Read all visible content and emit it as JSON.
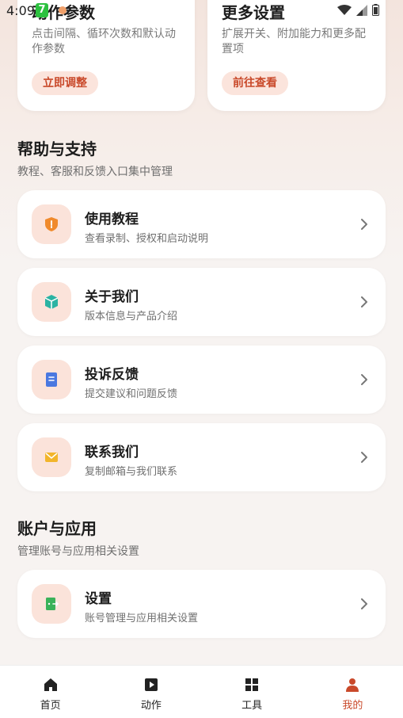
{
  "status_bar": {
    "time": "4:09",
    "app_badge": "7"
  },
  "top_cards": [
    {
      "title": "动作参数",
      "desc": "点击间隔、循环次数和默认动作参数",
      "button": "立即调整"
    },
    {
      "title": "更多设置",
      "desc": "扩展开关、附加能力和更多配置项",
      "button": "前往查看"
    }
  ],
  "help_section": {
    "title": "帮助与支持",
    "subtitle": "教程、客服和反馈入口集中管理",
    "items": [
      {
        "title": "使用教程",
        "subtitle": "查看录制、授权和启动说明",
        "icon": "shield-icon",
        "color": "#f08a2c"
      },
      {
        "title": "关于我们",
        "subtitle": "版本信息与产品介绍",
        "icon": "cube-icon",
        "color": "#2bb3a3"
      },
      {
        "title": "投诉反馈",
        "subtitle": "提交建议和问题反馈",
        "icon": "document-icon",
        "color": "#4a78e0"
      },
      {
        "title": "联系我们",
        "subtitle": "复制邮箱与我们联系",
        "icon": "mail-icon",
        "color": "#f2b52b"
      }
    ]
  },
  "account_section": {
    "title": "账户与应用",
    "subtitle": "管理账号与应用相关设置",
    "items": [
      {
        "title": "设置",
        "subtitle": "账号管理与应用相关设置",
        "icon": "door-icon",
        "color": "#3ab25a"
      }
    ]
  },
  "bottom_nav": [
    {
      "label": "首页",
      "icon": "home-icon",
      "active": false
    },
    {
      "label": "动作",
      "icon": "play-icon",
      "active": false
    },
    {
      "label": "工具",
      "icon": "grid-icon",
      "active": false
    },
    {
      "label": "我的",
      "icon": "person-icon",
      "active": true
    }
  ],
  "colors": {
    "accent": "#c9492a",
    "tile_bg": "#fbe3da"
  }
}
